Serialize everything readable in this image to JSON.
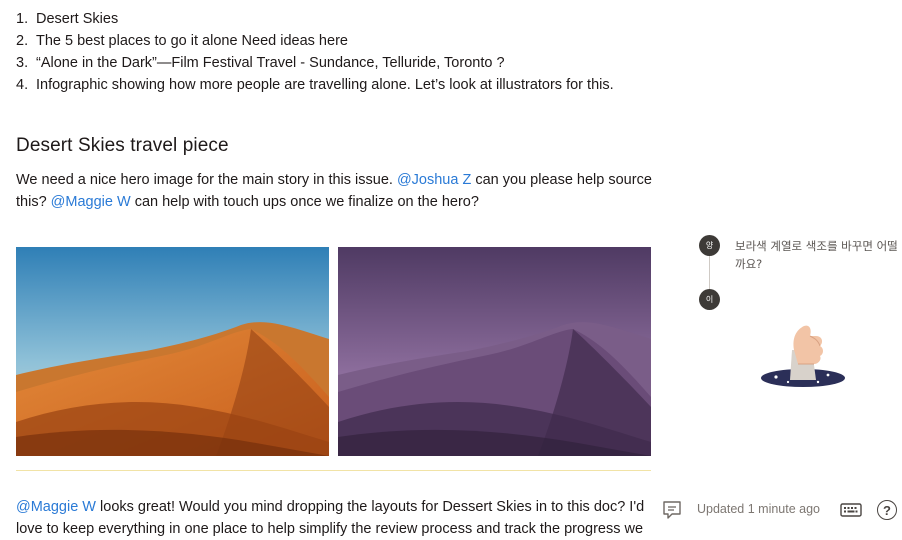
{
  "agenda": {
    "items": [
      {
        "num": "1.",
        "text": "Desert Skies"
      },
      {
        "num": "2.",
        "text": "The 5 best places to go it alone Need ideas here"
      },
      {
        "num": "3.",
        "text": "“Alone in the Dark”—Film Festival Travel - Sundance, Telluride, Toronto ?"
      },
      {
        "num": "4.",
        "text": "Infographic showing how more people are travelling alone. Let’s look at illustrators for this."
      }
    ]
  },
  "section": {
    "heading": "Desert Skies travel piece",
    "intro": {
      "part1": "We need a nice hero image for the main story in this issue. ",
      "mention1": "@Joshua Z",
      "part2": " can you please help source this? ",
      "mention2": "@Maggie W",
      "part3": " can help with touch ups once we finalize on the hero?"
    },
    "reply": {
      "mention": "@Maggie W",
      "text": " looks great! Would you mind dropping the layouts for Dessert Skies in to this doc? I'd love to keep everything in one place to help simplify the review process and track the progress we"
    }
  },
  "comments": {
    "avatar1": "양",
    "avatar2": "이",
    "text": "보라색 계열로 색조를 바꾸면 어떨까요?"
  },
  "footer": {
    "updated": "Updated 1 minute ago",
    "icons": [
      "comment-icon",
      "keyboard-icon",
      "help-icon"
    ],
    "help_glyph": "?"
  },
  "colors": {
    "mention": "#2a7ad6",
    "divider": "#f1e3a6",
    "avatar": "#3d3a37"
  }
}
